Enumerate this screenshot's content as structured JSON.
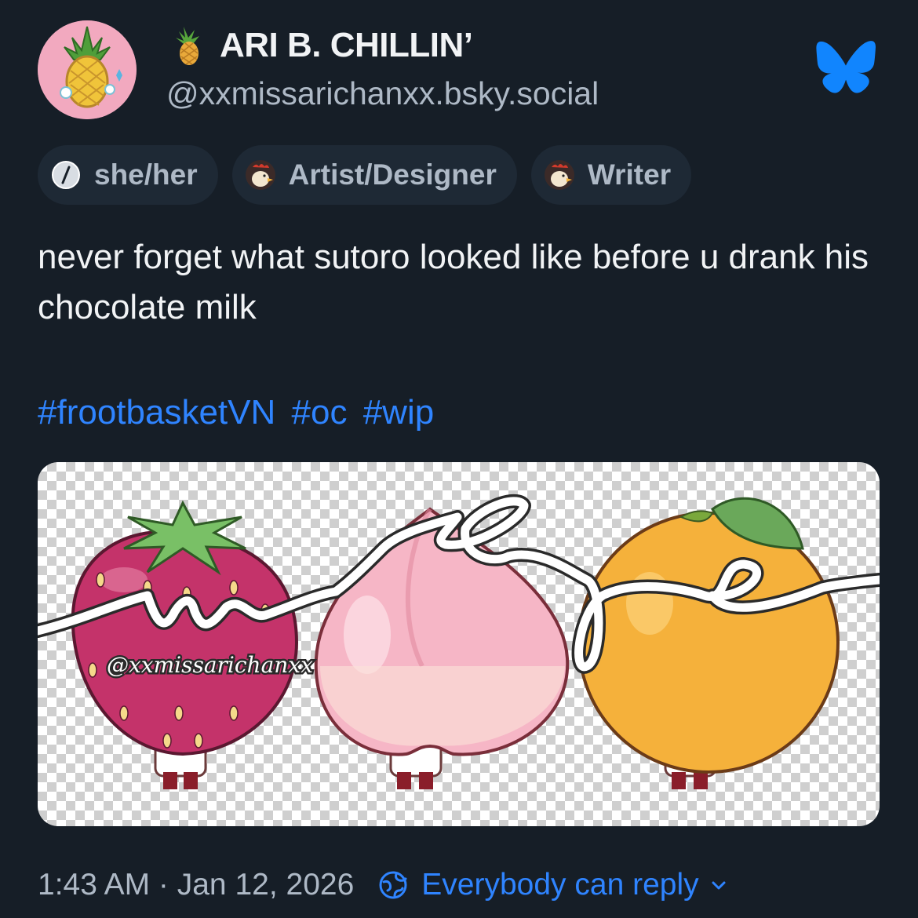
{
  "author": {
    "display_name": "ARI B. CHILLIN’",
    "handle": "@xxmissarichanxx.bsky.social",
    "name_emoji": "pineapple-icon",
    "avatar": "pineapple-avatar"
  },
  "badges": [
    {
      "label": "she/her",
      "icon": "pronoun-icon"
    },
    {
      "label": "Artist/Designer",
      "icon": "rooster-icon"
    },
    {
      "label": "Writer",
      "icon": "rooster-icon"
    }
  ],
  "post": {
    "text": "never forget what sutoro looked like before u drank his chocolate milk",
    "hashtags": [
      "#frootbasketVN",
      "#oc",
      "#wip"
    ],
    "image": {
      "watermark": "@xxmissarichanxx",
      "overlay_word": "wip"
    }
  },
  "footer": {
    "timestamp": "1:43 AM · Jan 12, 2026",
    "reply_setting": "Everybody can reply"
  },
  "colors": {
    "background": "#161e27",
    "accent": "#2f84ff",
    "muted_text": "#aeb9c6",
    "badge_bg": "#1e2935"
  }
}
